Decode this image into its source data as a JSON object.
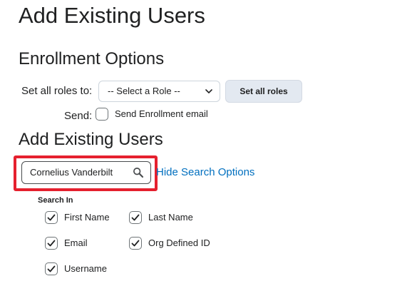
{
  "page": {
    "title": "Add Existing Users"
  },
  "enrollment": {
    "title": "Enrollment Options",
    "set_roles_label": "Set all roles to:",
    "role_select_value": "-- Select a Role --",
    "set_all_roles_button": "Set all roles",
    "send_label": "Send:",
    "send_email_checkbox": {
      "label": "Send Enrollment email",
      "checked": false
    }
  },
  "add_users": {
    "title": "Add Existing Users",
    "search_value": "Cornelius Vanderbilt",
    "hide_search_options_link": "Hide Search Options",
    "search_in_label": "Search In",
    "fields": [
      {
        "label": "First Name",
        "checked": true
      },
      {
        "label": "Last Name",
        "checked": true
      },
      {
        "label": "Email",
        "checked": true
      },
      {
        "label": "Org Defined ID",
        "checked": true
      },
      {
        "label": "Username",
        "checked": true
      }
    ]
  },
  "colors": {
    "link": "#006fbf",
    "highlight": "#e5202e",
    "button_bg": "#e3e9f1"
  }
}
